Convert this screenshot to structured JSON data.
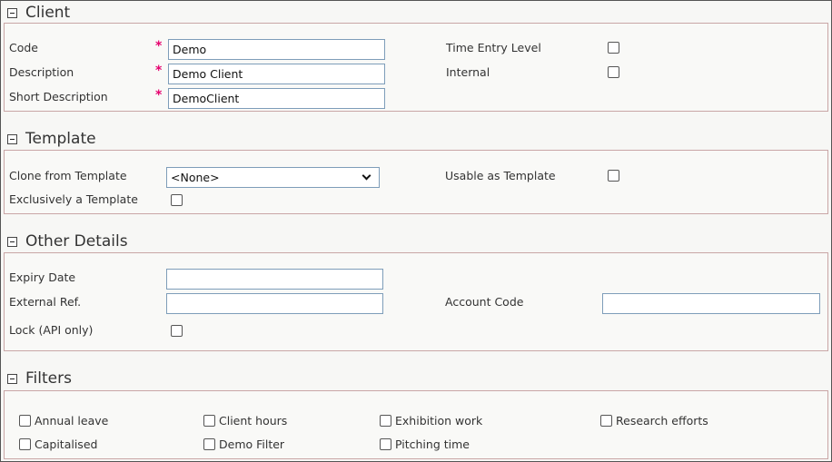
{
  "client": {
    "title": "Client",
    "code_label": "Code",
    "code_value": "Demo",
    "description_label": "Description",
    "description_value": "Demo Client",
    "short_description_label": "Short Description",
    "short_description_value": "DemoClient",
    "required_mark": "*",
    "time_entry_level_label": "Time Entry Level",
    "internal_label": "Internal"
  },
  "template": {
    "title": "Template",
    "clone_label": "Clone from Template",
    "clone_selected": "<None>",
    "usable_label": "Usable as Template",
    "exclusive_label": "Exclusively a Template"
  },
  "other": {
    "title": "Other Details",
    "expiry_label": "Expiry Date",
    "expiry_value": "",
    "external_ref_label": "External Ref.",
    "external_ref_value": "",
    "account_code_label": "Account Code",
    "account_code_value": "",
    "lock_label": "Lock (API only)"
  },
  "filters": {
    "title": "Filters",
    "items": [
      "Annual leave",
      "Client hours",
      "Exhibition work",
      "Research efforts",
      "Capitalised",
      "Demo Filter",
      "Pitching time"
    ]
  },
  "colors": {
    "required": "#e5006e",
    "section_border": "#c9a6a6",
    "input_border": "#7e9db9"
  }
}
